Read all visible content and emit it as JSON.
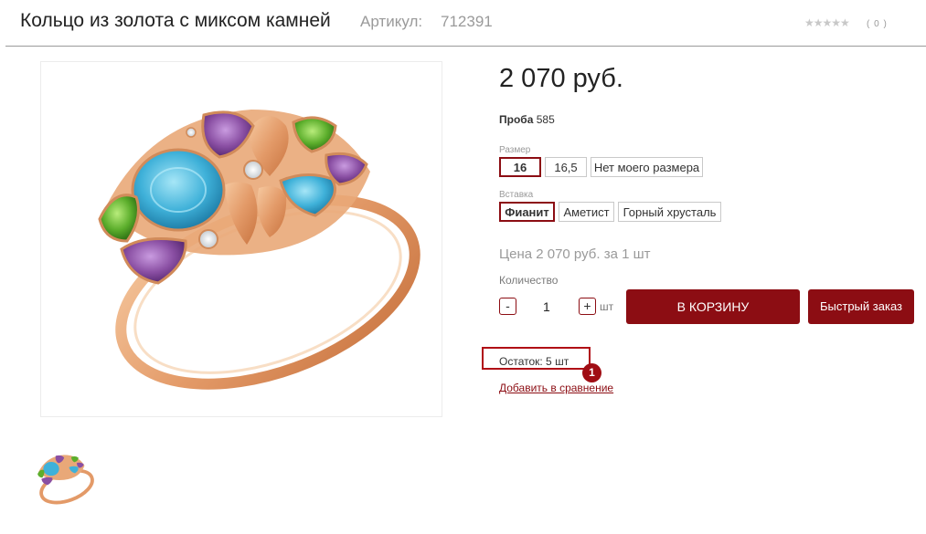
{
  "header": {
    "title": "Кольцо из золота с миксом камней",
    "article_label": "Артикул:",
    "article_value": "712391",
    "rating_stars": "★★★★★",
    "rating_count": "( 0 )",
    "rating_value": 0
  },
  "product": {
    "price": "2 070 руб.",
    "proba_label": "Проба",
    "proba_value": "585",
    "size_label": "Размер",
    "sizes": [
      "16",
      "16,5",
      "Нет моего размера"
    ],
    "size_selected": "16",
    "insert_label": "Вставка",
    "inserts": [
      "Фианит",
      "Аметист",
      "Горный хрусталь"
    ],
    "insert_selected": "Фианит",
    "price_per": "Цена 2 070 руб. за 1 шт",
    "quantity_label": "Количество",
    "qty_minus": "-",
    "qty_plus": "+",
    "quantity": "1",
    "quantity_unit": "шт",
    "cart_button": "В КОРЗИНУ",
    "quick_order_button": "Быстрый заказ",
    "stock_text": "Остаток: 5 шт",
    "marker": "1",
    "compare_link": "Добавить в сравнение"
  },
  "colors": {
    "accent": "#8c0d13",
    "gold": "#e9a878",
    "blue_topaz": "#3fb1d9",
    "amethyst": "#8a4fa3",
    "peridot": "#5cae2c"
  }
}
